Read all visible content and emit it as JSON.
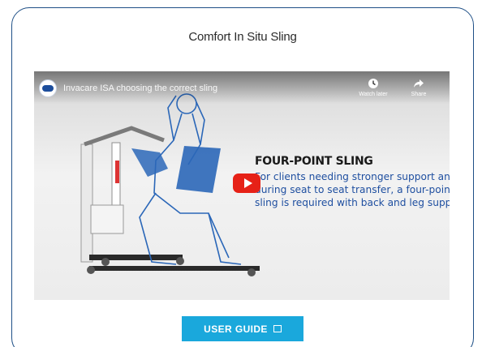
{
  "card": {
    "title": "Comfort In Situ Sling"
  },
  "video": {
    "title": "Invacare ISA choosing the correct sling",
    "actions": [
      {
        "label": "Watch later",
        "icon": "clock-icon"
      },
      {
        "label": "Share",
        "icon": "share-arrow-icon"
      }
    ],
    "headline": "FOUR-POINT SLING",
    "description_lines": [
      "For clients needing stronger support and stability",
      "during seat to seat transfer, a four-point attachment",
      "sling is required with back and leg support."
    ],
    "play_icon": "play-icon",
    "colors": {
      "play": "#e62117",
      "text": "#1f4fa0",
      "sling": "#2b67b8"
    }
  },
  "guide_button": {
    "label": "USER GUIDE",
    "icon": "external-box-icon",
    "color": "#1aa8dc"
  },
  "colors": {
    "border": "#1e4f86"
  }
}
